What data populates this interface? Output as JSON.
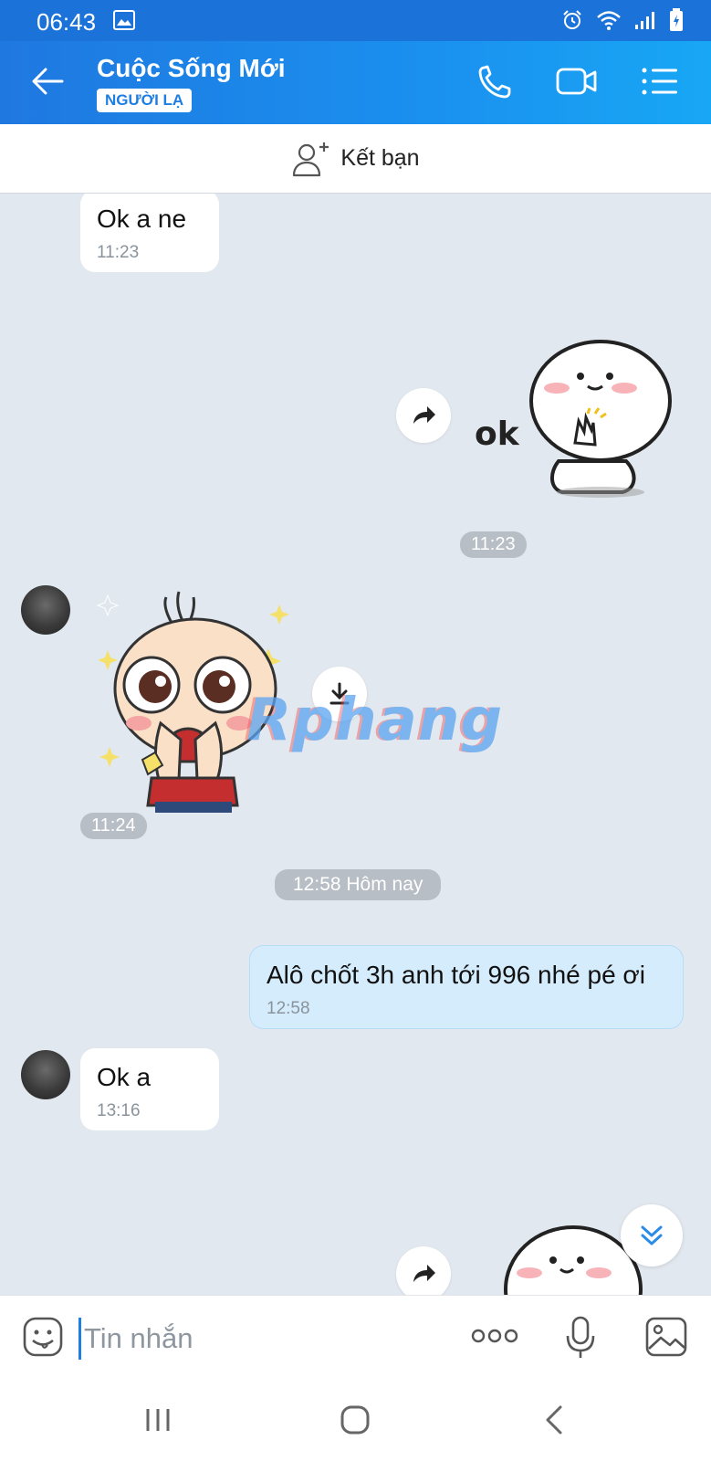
{
  "status_bar": {
    "time": "06:43"
  },
  "header": {
    "title": "Cuộc Sống Mới",
    "badge": "NGƯỜI LẠ"
  },
  "friend_bar": {
    "label": "Kết bạn"
  },
  "messages": [
    {
      "side": "in",
      "type": "text",
      "text": "Ok a ne",
      "time": "11:23"
    },
    {
      "side": "out",
      "type": "sticker",
      "sticker": "ok-blob-sticker",
      "sticker_text": "ok",
      "time": "11:23"
    },
    {
      "side": "in",
      "type": "sticker",
      "sticker": "surprised-boy-sticker",
      "time": "11:24"
    },
    {
      "side": "center",
      "type": "separator",
      "text": "12:58 Hôm nay"
    },
    {
      "side": "out",
      "type": "text",
      "text": "Alô chốt 3h anh tới 996 nhé pé ơi",
      "time": "12:58"
    },
    {
      "side": "in",
      "type": "text",
      "text": "Ok a",
      "time": "13:16"
    },
    {
      "side": "out",
      "type": "sticker",
      "sticker": "blob-sticker-partial"
    }
  ],
  "watermark": "Rphang",
  "input": {
    "placeholder": "Tin nhắn"
  },
  "colors": {
    "header": "#1a8af0",
    "outgoing_bubble": "#d5ecfd",
    "chat_bg": "#e2e8ef",
    "accent": "#1e7ee3"
  }
}
